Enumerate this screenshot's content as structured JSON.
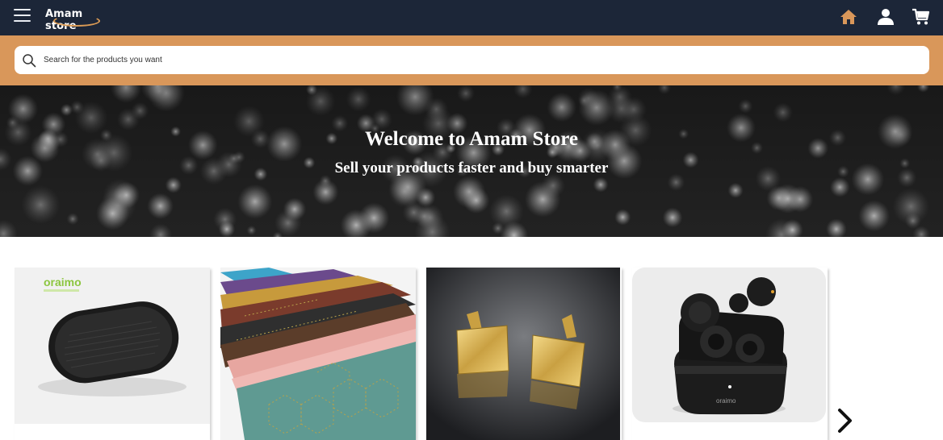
{
  "header": {
    "brand": "Amam store",
    "nav_icons": [
      "home-icon",
      "user-icon",
      "cart-icon"
    ],
    "accent_color": "#d9975a",
    "background_color": "#1c2638"
  },
  "search": {
    "placeholder": "Search for the products you want"
  },
  "hero": {
    "title": "Welcome to Amam Store",
    "subtitle": "Sell your products faster and buy smarter"
  },
  "products": [
    {
      "image": "bluetooth-speaker",
      "brand_mark": "oraimo"
    },
    {
      "image": "scarves"
    },
    {
      "image": "cufflinks"
    },
    {
      "image": "wireless-earbuds",
      "brand_mark": "oraimo"
    }
  ],
  "carousel": {
    "next_icon": "chevron-right-icon"
  }
}
